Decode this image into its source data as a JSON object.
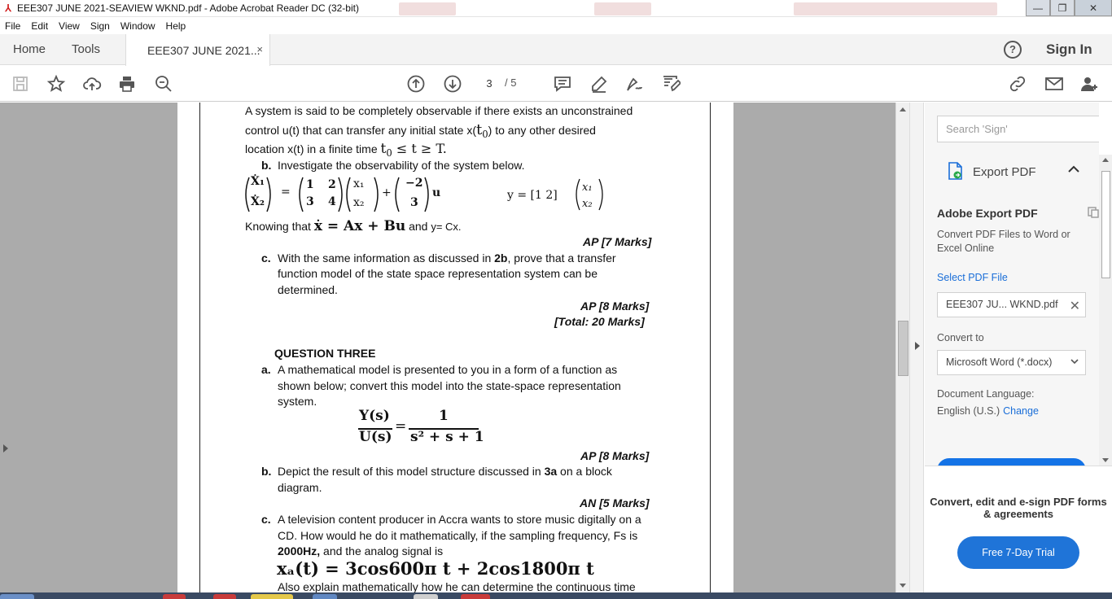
{
  "window": {
    "title": "EEE307 JUNE 2021-SEAVIEW WKND.pdf - Adobe Acrobat Reader DC (32-bit)",
    "minimize": "—",
    "maximize": "❐",
    "close": "✕"
  },
  "menu": [
    "File",
    "Edit",
    "View",
    "Sign",
    "Window",
    "Help"
  ],
  "tabs": {
    "home": "Home",
    "tools": "Tools",
    "document": "EEE307 JUNE 2021...",
    "close": "×",
    "help": "?",
    "sign_in": "Sign In"
  },
  "toolbar": {
    "icons": [
      "save-icon",
      "bookmark-star-icon",
      "upload-cloud-icon",
      "print-icon",
      "zoom-out-icon",
      "page-up-icon",
      "page-down-icon",
      "comment-icon",
      "highlight-pen-icon",
      "fill-sign-icon",
      "edit-pdf-icon",
      "share-link-icon",
      "email-icon",
      "add-user-icon"
    ],
    "page_current": "3",
    "page_total": "/ 5"
  },
  "document": {
    "lines": {
      "l1": "A system is said to be completely observable if there exists an unconstrained",
      "l2a": "control u(t) that can transfer any initial state x(",
      "l2b": "t",
      "l2c": "0",
      "l2d": ")  to any other desired",
      "l3a": "location x(t) in a finite time ",
      "l3b": "t",
      "l3c": "0",
      "l3d": " ≤ t ≥ T.",
      "b_label": "b.",
      "b_text": "Investigate the observability of the system below.",
      "eq_y": "y = [1  2]",
      "know_a": "Knowing that ",
      "know_b": "ẋ = Ax + Bu",
      "know_c": " and ",
      "know_d": "y= Cx.",
      "ap7": "AP [7 Marks]",
      "c_label": "c.",
      "c1a": "With the same information as discussed in ",
      "c1b": "2b",
      "c1c": ", prove that a transfer",
      "c2": "function model of the state space representation system can be",
      "c3": "determined.",
      "ap8": "AP [8 Marks]",
      "total": "[Total: 20 Marks]",
      "q3": "QUESTION THREE",
      "a_label": "a.",
      "a1": "A mathematical model is presented to you in a form of a function as",
      "a2": "shown below; convert this model into the state-space representation",
      "a3": "system.",
      "frac_num_l": "Y(s)",
      "frac_den_l": "U(s)",
      "frac_eq": "=",
      "frac_num_r": "1",
      "frac_den_r": "s² + s + 1",
      "ap8b": "AP [8 Marks]",
      "b2_label": "b.",
      "b2a": "Depict the result of this model structure discussed in ",
      "b2b": "3a",
      "b2c": " on a block",
      "b2d": "diagram.",
      "an5": "AN [5 Marks]",
      "c2_label": "c.",
      "c21": "A television content producer in Accra wants to store music digitally on a",
      "c22": "CD. How would he do it mathematically, if the sampling frequency, Fs is",
      "c23a": "2000Hz,",
      "c23b": " and the analog signal is",
      "xa": "xₐ(t) = 3cos600π t + 2cos1800π t",
      "c24": "Also explain mathematically how he can determine the continuous time"
    },
    "matrix": {
      "x1": "Ẋ₁",
      "x2": "Ẋ₂",
      "eq": "=",
      "a11": "1",
      "a12": "2",
      "a21": "3",
      "a22": "4",
      "v1": "x₁",
      "v2": "x₂",
      "plus": "+",
      "b1": "−2",
      "b2": "3",
      "u": "u",
      "y1": "x₁",
      "y2": "x₂"
    }
  },
  "right_pane": {
    "search_placeholder": "Search 'Sign'",
    "export_label": "Export PDF",
    "title": "Adobe Export PDF",
    "desc": "Convert PDF Files to Word or Excel Online",
    "select_file": "Select PDF File",
    "file_name": "EEE307 JU... WKND.pdf",
    "file_clear": "✕",
    "convert_to_label": "Convert to",
    "convert_to_value": "Microsoft Word (*.docx)",
    "doc_lang_label": "Document Language:",
    "doc_lang_value": "English (U.S.)",
    "change": "Change",
    "promo_text": "Convert, edit and e-sign PDF forms & agreements",
    "trial_button": "Free 7-Day Trial"
  },
  "colors": {
    "accent": "#1473e6",
    "doc_background": "#ababab",
    "link": "#1a6ed8"
  }
}
